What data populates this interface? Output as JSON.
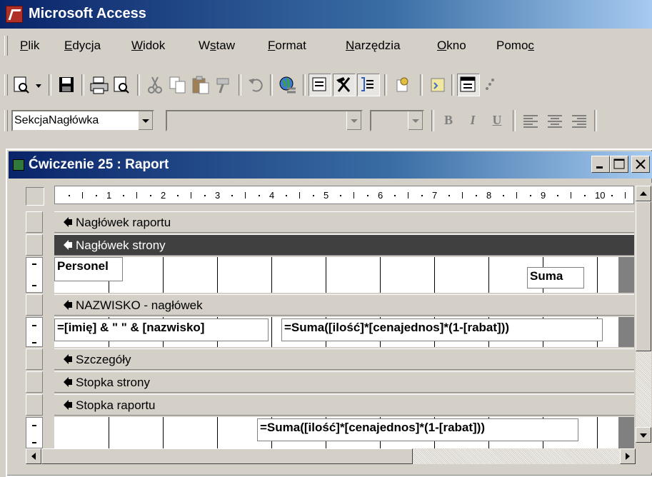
{
  "app": {
    "title": "Microsoft Access"
  },
  "menu": {
    "items": [
      {
        "label": "Plik",
        "u": "P",
        "rest": "lik"
      },
      {
        "label": "Edycja",
        "u": "E",
        "rest": "dycja"
      },
      {
        "label": "Widok",
        "u": "W",
        "rest": "idok"
      },
      {
        "label": "Wstaw",
        "pre": "W",
        "u": "s",
        "rest": "taw"
      },
      {
        "label": "Format",
        "u": "F",
        "rest": "ormat"
      },
      {
        "label": "Narzędzia",
        "u": "N",
        "rest": "arzędzia"
      },
      {
        "label": "Okno",
        "u": "O",
        "rest": "kno"
      },
      {
        "label": "Pomoc",
        "pre": "Pomo",
        "u": "c",
        "rest": ""
      }
    ]
  },
  "toolbar": {
    "buttons": [
      "print-preview-icon",
      "save-icon",
      "print-icon",
      "preview-icon",
      "cut-icon",
      "copy-icon",
      "paste-icon",
      "format-painter-icon",
      "undo-icon",
      "hyperlink-icon",
      "field-list-icon",
      "toolbox-icon",
      "sorting-grouping-icon",
      "autoformat-icon",
      "code-icon",
      "properties-icon"
    ]
  },
  "format_toolbar": {
    "object_combo": "SekcjaNagłówka",
    "bold": "B",
    "italic": "I",
    "underline": "U"
  },
  "report": {
    "title": "Ćwiczenie 25 : Raport",
    "ruler": [
      "1",
      "2",
      "3",
      "4",
      "5",
      "6",
      "7",
      "8",
      "9",
      "10"
    ],
    "bands": {
      "report_header": "Nagłówek raportu",
      "page_header": "Nagłówek strony",
      "group_header": "NAZWISKO - nagłówek",
      "detail": "Szczegóły",
      "page_footer": "Stopka strony",
      "report_footer": "Stopka raportu"
    },
    "controls": {
      "personel_label": "Personel",
      "suma_label": "Suma",
      "name_expr": "=[imię] & \" \" & [nazwisko]",
      "group_sum_expr": "=Suma([ilość]*[cenajednos]*(1-[rabat]))",
      "report_sum_expr": "=Suma([ilość]*[cenajednos]*(1-[rabat]))"
    }
  }
}
